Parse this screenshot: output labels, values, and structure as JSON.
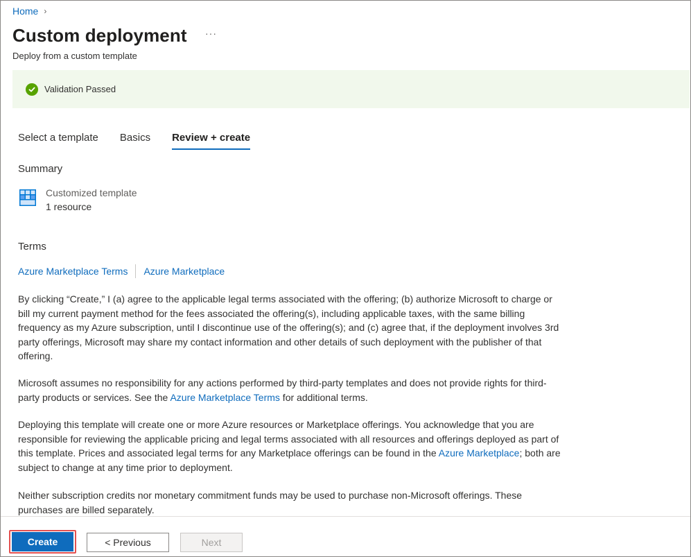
{
  "breadcrumb": {
    "home": "Home",
    "chevron": "›"
  },
  "header": {
    "title": "Custom deployment",
    "more": "···",
    "subtitle": "Deploy from a custom template"
  },
  "banner": {
    "message": "Validation Passed",
    "color": "#57a300"
  },
  "tabs": [
    {
      "label": "Select a template"
    },
    {
      "label": "Basics"
    },
    {
      "label": "Review + create"
    }
  ],
  "summary": {
    "heading": "Summary",
    "resource_name": "Customized template",
    "resource_count": "1 resource",
    "icon": "template-grid-icon"
  },
  "terms": {
    "heading": "Terms",
    "link1": "Azure Marketplace Terms",
    "link2": "Azure Marketplace",
    "para1": "By clicking “Create,” I (a) agree to the applicable legal terms associated with the offering; (b) authorize Microsoft to charge or bill my current payment method for the fees associated the offering(s), including applicable taxes, with the same billing frequency as my Azure subscription, until I discontinue use of the offering(s); and (c) agree that, if the deployment involves 3rd party offerings, Microsoft may share my contact information and other details of such deployment with the publisher of that offering.",
    "para2_a": "Microsoft assumes no responsibility for any actions performed by third-party templates and does not provide rights for third-party products or services. See the ",
    "para2_link": "Azure Marketplace Terms",
    "para2_b": " for additional terms.",
    "para3_a": "Deploying this template will create one or more Azure resources or Marketplace offerings.  You acknowledge that you are responsible for reviewing the applicable pricing and legal terms associated with all resources and offerings deployed as part of this template.  Prices and associated legal terms for any Marketplace offerings can be found in the ",
    "para3_link": "Azure Marketplace",
    "para3_b": "; both are subject to change at any time prior to deployment.",
    "para4": "Neither subscription credits nor monetary commitment funds may be used to purchase non-Microsoft offerings. These purchases are billed separately."
  },
  "footer": {
    "create": "Create",
    "previous": "< Previous",
    "next": "Next"
  },
  "colors": {
    "accent": "#0f6cbd",
    "success": "#57a300",
    "highlight": "#e35050"
  }
}
